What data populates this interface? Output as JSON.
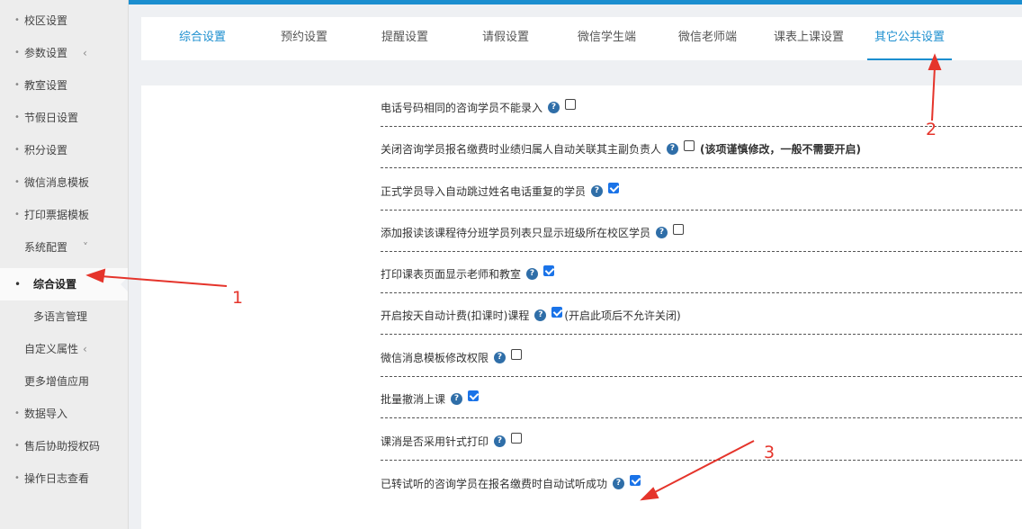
{
  "sidebar": {
    "items": [
      {
        "label": "校区设置",
        "arrow": ""
      },
      {
        "label": "参数设置",
        "arrow": "‹"
      },
      {
        "label": "教室设置",
        "arrow": ""
      },
      {
        "label": "节假日设置",
        "arrow": ""
      },
      {
        "label": "积分设置",
        "arrow": ""
      },
      {
        "label": "微信消息模板",
        "arrow": ""
      },
      {
        "label": "打印票据模板",
        "arrow": "‹"
      },
      {
        "label": "系统配置",
        "arrow": "˅"
      },
      {
        "label": "综合设置",
        "arrow": ""
      },
      {
        "label": "多语言管理",
        "arrow": ""
      },
      {
        "label": "自定义属性",
        "arrow": "‹"
      },
      {
        "label": "更多增值应用",
        "arrow": "‹"
      },
      {
        "label": "数据导入",
        "arrow": ""
      },
      {
        "label": "售后协助授权码",
        "arrow": ""
      },
      {
        "label": "操作日志查看",
        "arrow": ""
      }
    ]
  },
  "tabs": [
    {
      "label": "综合设置"
    },
    {
      "label": "预约设置"
    },
    {
      "label": "提醒设置"
    },
    {
      "label": "请假设置"
    },
    {
      "label": "微信学生端"
    },
    {
      "label": "微信老师端"
    },
    {
      "label": "课表上课设置"
    },
    {
      "label": "其它公共设置"
    }
  ],
  "settings": [
    {
      "label": "电话号码相同的咨询学员不能录入",
      "checked": false,
      "note": ""
    },
    {
      "label": "关闭咨询学员报名缴费时业绩归属人自动关联其主副负责人",
      "checked": false,
      "note": "(该项谨慎修改，一般不需要开启)"
    },
    {
      "label": "正式学员导入自动跳过姓名电话重复的学员",
      "checked": true,
      "note": ""
    },
    {
      "label": "添加报读该课程待分班学员列表只显示班级所在校区学员",
      "checked": false,
      "note": ""
    },
    {
      "label": "打印课表页面显示老师和教室",
      "checked": true,
      "note": ""
    },
    {
      "label": "开启按天自动计费(扣课时)课程",
      "checked": true,
      "note": "(开启此项后不允许关闭)"
    },
    {
      "label": "微信消息模板修改权限",
      "checked": false,
      "note": ""
    },
    {
      "label": "批量撤消上课",
      "checked": true,
      "note": ""
    },
    {
      "label": "课消是否采用针式打印",
      "checked": false,
      "note": ""
    },
    {
      "label": "已转试听的咨询学员在报名缴费时自动试听成功",
      "checked": true,
      "note": ""
    }
  ],
  "help_glyph": "?",
  "annotations": {
    "n1": "1",
    "n2": "2",
    "n3": "3",
    "color": "#e5342b"
  },
  "colors": {
    "accent": "#1b8ecf",
    "checkbox": "#1a73e8"
  }
}
